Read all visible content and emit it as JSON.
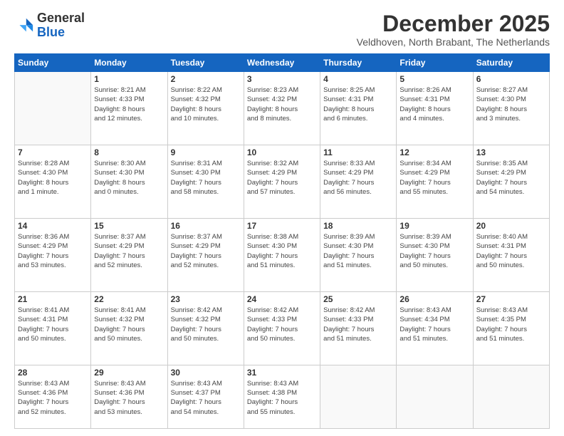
{
  "logo": {
    "general": "General",
    "blue": "Blue"
  },
  "header": {
    "month": "December 2025",
    "location": "Veldhoven, North Brabant, The Netherlands"
  },
  "weekdays": [
    "Sunday",
    "Monday",
    "Tuesday",
    "Wednesday",
    "Thursday",
    "Friday",
    "Saturday"
  ],
  "weeks": [
    [
      {
        "day": "",
        "info": ""
      },
      {
        "day": "1",
        "info": "Sunrise: 8:21 AM\nSunset: 4:33 PM\nDaylight: 8 hours\nand 12 minutes."
      },
      {
        "day": "2",
        "info": "Sunrise: 8:22 AM\nSunset: 4:32 PM\nDaylight: 8 hours\nand 10 minutes."
      },
      {
        "day": "3",
        "info": "Sunrise: 8:23 AM\nSunset: 4:32 PM\nDaylight: 8 hours\nand 8 minutes."
      },
      {
        "day": "4",
        "info": "Sunrise: 8:25 AM\nSunset: 4:31 PM\nDaylight: 8 hours\nand 6 minutes."
      },
      {
        "day": "5",
        "info": "Sunrise: 8:26 AM\nSunset: 4:31 PM\nDaylight: 8 hours\nand 4 minutes."
      },
      {
        "day": "6",
        "info": "Sunrise: 8:27 AM\nSunset: 4:30 PM\nDaylight: 8 hours\nand 3 minutes."
      }
    ],
    [
      {
        "day": "7",
        "info": "Sunrise: 8:28 AM\nSunset: 4:30 PM\nDaylight: 8 hours\nand 1 minute."
      },
      {
        "day": "8",
        "info": "Sunrise: 8:30 AM\nSunset: 4:30 PM\nDaylight: 8 hours\nand 0 minutes."
      },
      {
        "day": "9",
        "info": "Sunrise: 8:31 AM\nSunset: 4:30 PM\nDaylight: 7 hours\nand 58 minutes."
      },
      {
        "day": "10",
        "info": "Sunrise: 8:32 AM\nSunset: 4:29 PM\nDaylight: 7 hours\nand 57 minutes."
      },
      {
        "day": "11",
        "info": "Sunrise: 8:33 AM\nSunset: 4:29 PM\nDaylight: 7 hours\nand 56 minutes."
      },
      {
        "day": "12",
        "info": "Sunrise: 8:34 AM\nSunset: 4:29 PM\nDaylight: 7 hours\nand 55 minutes."
      },
      {
        "day": "13",
        "info": "Sunrise: 8:35 AM\nSunset: 4:29 PM\nDaylight: 7 hours\nand 54 minutes."
      }
    ],
    [
      {
        "day": "14",
        "info": "Sunrise: 8:36 AM\nSunset: 4:29 PM\nDaylight: 7 hours\nand 53 minutes."
      },
      {
        "day": "15",
        "info": "Sunrise: 8:37 AM\nSunset: 4:29 PM\nDaylight: 7 hours\nand 52 minutes."
      },
      {
        "day": "16",
        "info": "Sunrise: 8:37 AM\nSunset: 4:29 PM\nDaylight: 7 hours\nand 52 minutes."
      },
      {
        "day": "17",
        "info": "Sunrise: 8:38 AM\nSunset: 4:30 PM\nDaylight: 7 hours\nand 51 minutes."
      },
      {
        "day": "18",
        "info": "Sunrise: 8:39 AM\nSunset: 4:30 PM\nDaylight: 7 hours\nand 51 minutes."
      },
      {
        "day": "19",
        "info": "Sunrise: 8:39 AM\nSunset: 4:30 PM\nDaylight: 7 hours\nand 50 minutes."
      },
      {
        "day": "20",
        "info": "Sunrise: 8:40 AM\nSunset: 4:31 PM\nDaylight: 7 hours\nand 50 minutes."
      }
    ],
    [
      {
        "day": "21",
        "info": "Sunrise: 8:41 AM\nSunset: 4:31 PM\nDaylight: 7 hours\nand 50 minutes."
      },
      {
        "day": "22",
        "info": "Sunrise: 8:41 AM\nSunset: 4:32 PM\nDaylight: 7 hours\nand 50 minutes."
      },
      {
        "day": "23",
        "info": "Sunrise: 8:42 AM\nSunset: 4:32 PM\nDaylight: 7 hours\nand 50 minutes."
      },
      {
        "day": "24",
        "info": "Sunrise: 8:42 AM\nSunset: 4:33 PM\nDaylight: 7 hours\nand 50 minutes."
      },
      {
        "day": "25",
        "info": "Sunrise: 8:42 AM\nSunset: 4:33 PM\nDaylight: 7 hours\nand 51 minutes."
      },
      {
        "day": "26",
        "info": "Sunrise: 8:43 AM\nSunset: 4:34 PM\nDaylight: 7 hours\nand 51 minutes."
      },
      {
        "day": "27",
        "info": "Sunrise: 8:43 AM\nSunset: 4:35 PM\nDaylight: 7 hours\nand 51 minutes."
      }
    ],
    [
      {
        "day": "28",
        "info": "Sunrise: 8:43 AM\nSunset: 4:36 PM\nDaylight: 7 hours\nand 52 minutes."
      },
      {
        "day": "29",
        "info": "Sunrise: 8:43 AM\nSunset: 4:36 PM\nDaylight: 7 hours\nand 53 minutes."
      },
      {
        "day": "30",
        "info": "Sunrise: 8:43 AM\nSunset: 4:37 PM\nDaylight: 7 hours\nand 54 minutes."
      },
      {
        "day": "31",
        "info": "Sunrise: 8:43 AM\nSunset: 4:38 PM\nDaylight: 7 hours\nand 55 minutes."
      },
      {
        "day": "",
        "info": ""
      },
      {
        "day": "",
        "info": ""
      },
      {
        "day": "",
        "info": ""
      }
    ]
  ]
}
